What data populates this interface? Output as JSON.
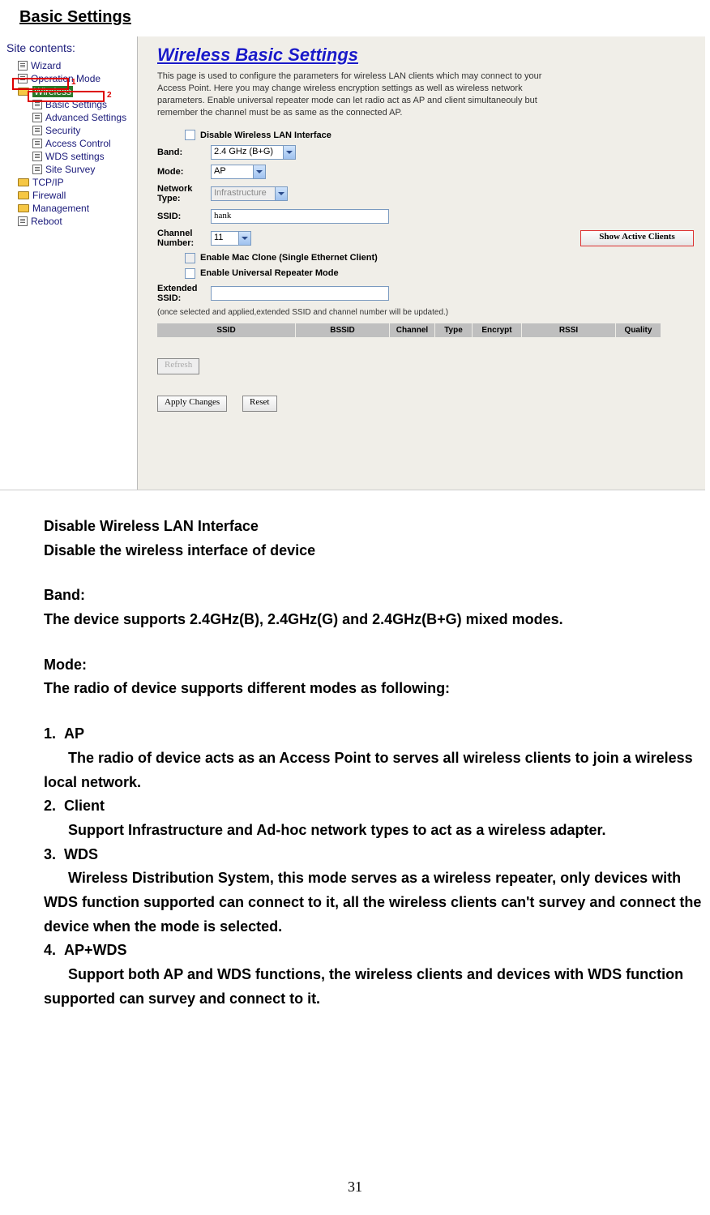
{
  "page": {
    "title": "Basic Settings",
    "number": "31"
  },
  "inset": {
    "sidebar": {
      "title": "Site contents:",
      "items": [
        {
          "label": "Wizard",
          "icon": "page",
          "indent": 1
        },
        {
          "label": "Operation Mode",
          "icon": "page",
          "indent": 1
        },
        {
          "label": "Wireless",
          "icon": "folder",
          "indent": 1,
          "selected": true,
          "marker": "1"
        },
        {
          "label": "Basic Settings",
          "icon": "page",
          "indent": 2,
          "marker": "2"
        },
        {
          "label": "Advanced Settings",
          "icon": "page",
          "indent": 2
        },
        {
          "label": "Security",
          "icon": "page",
          "indent": 2
        },
        {
          "label": "Access Control",
          "icon": "page",
          "indent": 2
        },
        {
          "label": "WDS settings",
          "icon": "page",
          "indent": 2
        },
        {
          "label": "Site Survey",
          "icon": "page",
          "indent": 2
        },
        {
          "label": "TCP/IP",
          "icon": "folder",
          "indent": 1
        },
        {
          "label": "Firewall",
          "icon": "folder",
          "indent": 1
        },
        {
          "label": "Management",
          "icon": "folder",
          "indent": 1
        },
        {
          "label": "Reboot",
          "icon": "page",
          "indent": 1
        }
      ]
    },
    "content": {
      "title": "Wireless Basic Settings",
      "description": "This page is used to configure the parameters for wireless LAN clients which may connect to your Access Point. Here you may change wireless encryption settings as well as wireless network parameters. Enable universal repeater mode can let radio act as AP and client simultaneouly but remember the channel must be as same as the connected AP.",
      "disable_label": "Disable Wireless LAN Interface",
      "band_label": "Band:",
      "band_value": "2.4 GHz (B+G)",
      "mode_label": "Mode:",
      "mode_value": "AP",
      "nettype_label": "Network Type:",
      "nettype_value": "Infrastructure",
      "ssid_label": "SSID:",
      "ssid_value": "hank",
      "chan_label": "Channel Number:",
      "chan_value": "11",
      "show_clients": "Show Active Clients",
      "mac_clone_label": "Enable Mac Clone (Single Ethernet Client)",
      "urep_label": "Enable Universal Repeater Mode",
      "extssid_label": "Extended SSID:",
      "extssid_value": "",
      "note": "(once selected and applied,extended SSID and channel number will be updated.)",
      "headers": [
        "SSID",
        "BSSID",
        "Channel",
        "Type",
        "Encrypt",
        "RSSI",
        "Quality"
      ],
      "refresh": "Refresh",
      "apply": "Apply Changes",
      "reset": "Reset"
    }
  },
  "doc": {
    "disable_h": "Disable Wireless LAN Interface",
    "disable_d": "Disable the wireless interface of device",
    "band_h": "Band:",
    "band_d": "The device supports 2.4GHz(B), 2.4GHz(G) and 2.4GHz(B+G) mixed modes.",
    "mode_h": "Mode:",
    "mode_d": "The radio of device supports different modes as following:",
    "modes": [
      {
        "num": "1.",
        "title": "AP",
        "desc": "The radio of device acts as an Access Point to serves all wireless clients to join a wireless local network."
      },
      {
        "num": "2.",
        "title": "Client",
        "desc": "Support Infrastructure and Ad-hoc network types to act as a wireless adapter."
      },
      {
        "num": "3.",
        "title": "WDS",
        "desc": "Wireless Distribution System, this mode serves as a wireless repeater, only devices with WDS function supported can connect to it, all the wireless clients can't survey and connect the device when the mode is selected."
      },
      {
        "num": "4.",
        "title": "AP+WDS",
        "desc": "Support both AP and WDS functions, the wireless clients and devices with WDS function supported can survey and connect to it."
      }
    ]
  }
}
